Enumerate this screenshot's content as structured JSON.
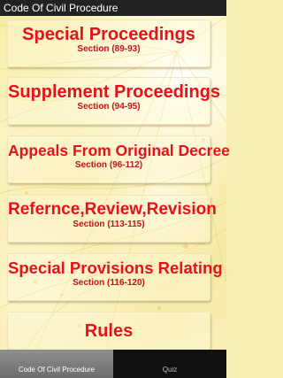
{
  "app": {
    "title": "Code Of Civil Procedure"
  },
  "menu": [
    {
      "title": "Special Proceedings",
      "section": "Section (89-93)"
    },
    {
      "title": "Supplement Proceedings",
      "section": "Section (94-95)"
    },
    {
      "title": "Appeals From Original Decree",
      "section": "Section (96-112)"
    },
    {
      "title": "Refernce,Review,Revision",
      "section": "Section (113-115)"
    },
    {
      "title": "Special Provisions Relating",
      "section": "Section (116-120)"
    },
    {
      "title": "Rules",
      "section": ""
    }
  ],
  "tabs": [
    {
      "label": "Code Of Civil Procedure",
      "active": true
    },
    {
      "label": "Quiz",
      "active": false
    }
  ]
}
